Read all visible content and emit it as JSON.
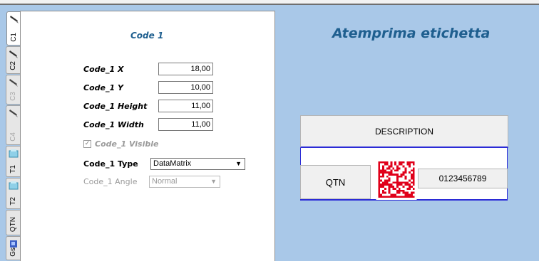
{
  "tabs": [
    {
      "label": "C1",
      "icon": "barcode-pen-icon",
      "active": true,
      "disabled": false
    },
    {
      "label": "C2",
      "icon": "barcode-pen-icon",
      "active": false,
      "disabled": false
    },
    {
      "label": "C3",
      "icon": "barcode-pen-icon",
      "active": false,
      "disabled": true
    },
    {
      "label": "C4",
      "icon": "barcode-pen-icon",
      "active": false,
      "disabled": true
    },
    {
      "label": "T1",
      "icon": "text-block-icon",
      "active": false,
      "disabled": false
    },
    {
      "label": "T2",
      "icon": "text-block-icon",
      "active": false,
      "disabled": false
    },
    {
      "label": "QTN",
      "icon": "",
      "active": false,
      "disabled": false
    },
    {
      "label": "Gs",
      "icon": "image-icon",
      "active": false,
      "disabled": false
    }
  ],
  "panel": {
    "title": "Code 1",
    "fields": [
      {
        "label": "Code_1 X",
        "value": "18,00"
      },
      {
        "label": "Code_1 Y",
        "value": "10,00"
      },
      {
        "label": "Code_1 Height",
        "value": "11,00"
      },
      {
        "label": "Code_1 Width",
        "value": "11,00"
      }
    ],
    "visible_label": "Code_1 Visible",
    "visible_checked": true,
    "type_label": "Code_1 Type",
    "type_value": "DataMatrix",
    "angle_label": "Code_1 Angle",
    "angle_value": "Normal"
  },
  "preview": {
    "title": "Atemprima etichetta",
    "description": "DESCRIPTION",
    "qtn": "QTN",
    "code_text": "0123456789"
  },
  "colors": {
    "background": "#a9c8e8",
    "title": "#1f5f8f",
    "matrix": "#e0001a",
    "frame": "#2b2bd6"
  }
}
